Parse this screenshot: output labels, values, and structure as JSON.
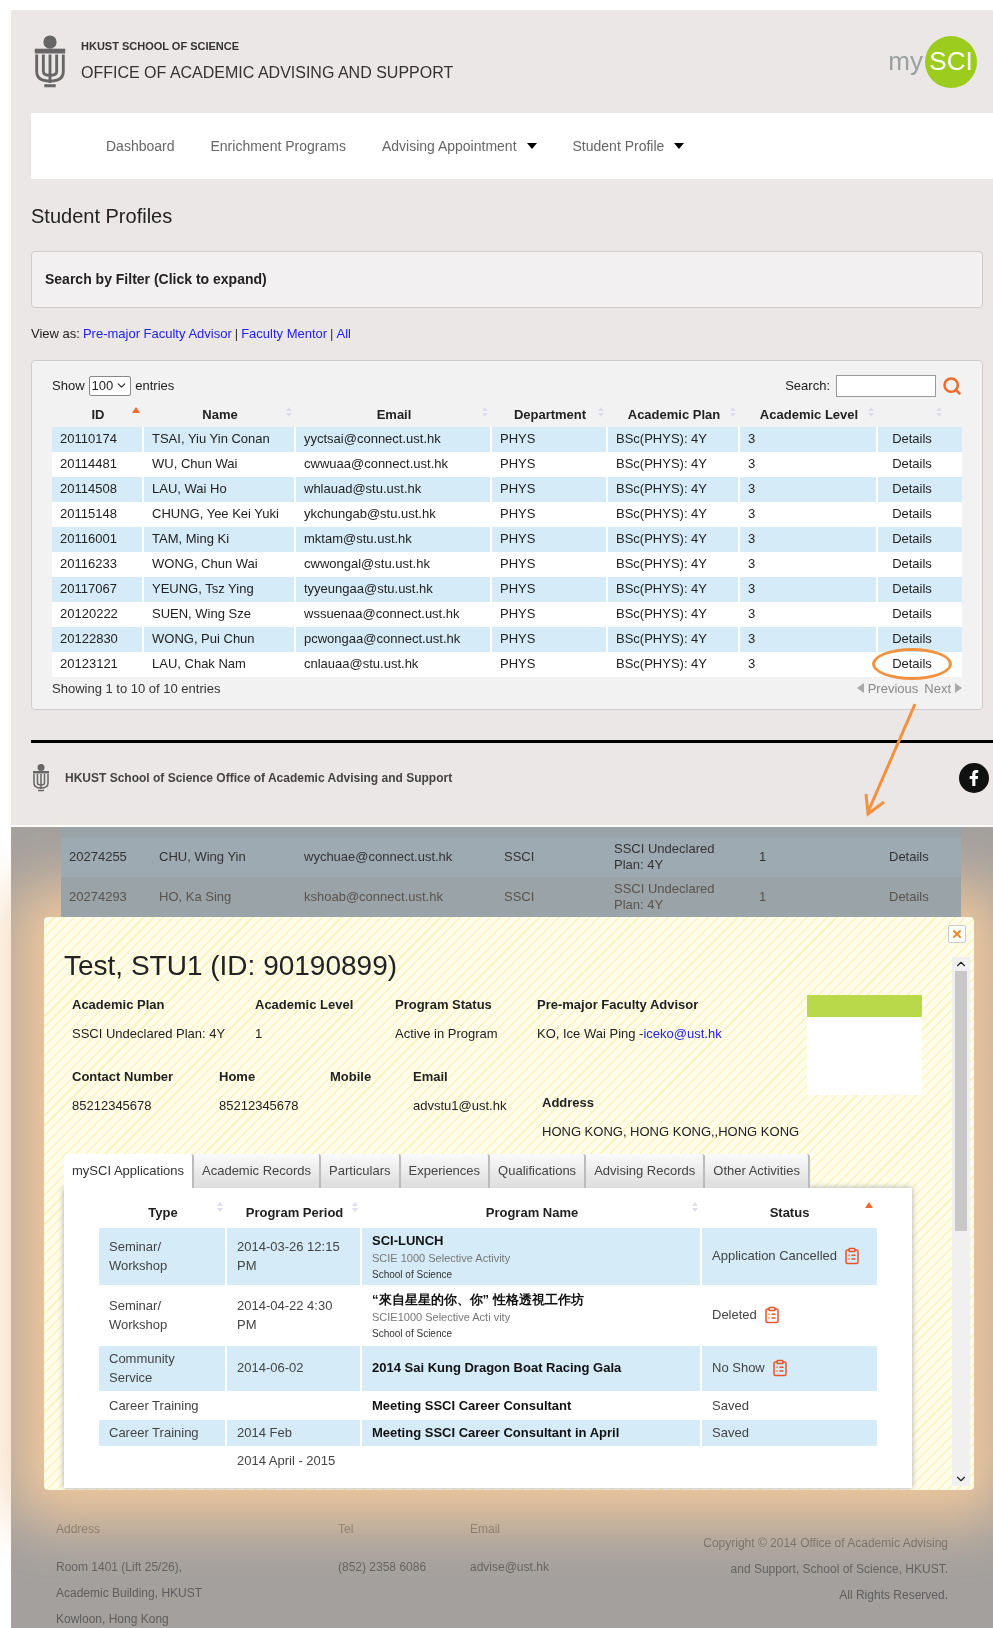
{
  "header": {
    "school": "HKUST SCHOOL OF SCIENCE",
    "office": "OFFICE OF ACADEMIC ADVISING AND SUPPORT",
    "logo_prefix": "my",
    "logo_badge": "SCI"
  },
  "nav": [
    {
      "label": "Dashboard",
      "has_dropdown": false
    },
    {
      "label": "Enrichment Programs",
      "has_dropdown": false
    },
    {
      "label": "Advising Appointment",
      "has_dropdown": true
    },
    {
      "label": "Student Profile",
      "has_dropdown": true
    }
  ],
  "page_title": "Student Profiles",
  "filter_panel": {
    "title": "Search by Filter (Click to expand)"
  },
  "view_as": {
    "label": "View as:",
    "separator": "|",
    "links": [
      "Pre-major Faculty Advisor",
      "Faculty Mentor",
      "All"
    ]
  },
  "table": {
    "show_label": "Show",
    "page_size": "100",
    "entries_label": "entries",
    "search_label": "Search:",
    "columns": [
      {
        "label": "ID",
        "sorted": true
      },
      {
        "label": "Name",
        "sorted": false
      },
      {
        "label": "Email",
        "sorted": false
      },
      {
        "label": "Department",
        "sorted": false
      },
      {
        "label": "Academic Plan",
        "sorted": false
      },
      {
        "label": "Academic Level",
        "sorted": false
      },
      {
        "sorted": false
      }
    ],
    "rows": [
      {
        "id": "20110174",
        "name": "TSAI, Yiu Yin Conan",
        "email": "yyctsai@connect.ust.hk",
        "department": "PHYS",
        "plan": "BSc(PHYS): 4Y",
        "level": "3",
        "action": "Details",
        "circled": false
      },
      {
        "id": "20114481",
        "name": "WU, Chun Wai",
        "email": "cwwuaa@connect.ust.hk",
        "department": "PHYS",
        "plan": "BSc(PHYS): 4Y",
        "level": "3",
        "action": "Details",
        "circled": false
      },
      {
        "id": "20114508",
        "name": "LAU, Wai Ho",
        "email": "whlauad@stu.ust.hk",
        "department": "PHYS",
        "plan": "BSc(PHYS): 4Y",
        "level": "3",
        "action": "Details",
        "circled": false
      },
      {
        "id": "20115148",
        "name": "CHUNG, Yee Kei Yuki",
        "email": "ykchungab@stu.ust.hk",
        "department": "PHYS",
        "plan": "BSc(PHYS): 4Y",
        "level": "3",
        "action": "Details",
        "circled": false
      },
      {
        "id": "20116001",
        "name": "TAM, Ming Ki",
        "email": "mktam@stu.ust.hk",
        "department": "PHYS",
        "plan": "BSc(PHYS): 4Y",
        "level": "3",
        "action": "Details",
        "circled": false
      },
      {
        "id": "20116233",
        "name": "WONG, Chun Wai",
        "email": "cwwongal@stu.ust.hk",
        "department": "PHYS",
        "plan": "BSc(PHYS): 4Y",
        "level": "3",
        "action": "Details",
        "circled": false
      },
      {
        "id": "20117067",
        "name": "YEUNG, Tsz Ying",
        "email": "tyyeungaa@stu.ust.hk",
        "department": "PHYS",
        "plan": "BSc(PHYS): 4Y",
        "level": "3",
        "action": "Details",
        "circled": false
      },
      {
        "id": "20120222",
        "name": "SUEN, Wing Sze",
        "email": "wssuenaa@connect.ust.hk",
        "department": "PHYS",
        "plan": "BSc(PHYS): 4Y",
        "level": "3",
        "action": "Details",
        "circled": false
      },
      {
        "id": "20122830",
        "name": "WONG, Pui Chun",
        "email": "pcwongaa@connect.ust.hk",
        "department": "PHYS",
        "plan": "BSc(PHYS): 4Y",
        "level": "3",
        "action": "Details",
        "circled": false
      },
      {
        "id": "20123121",
        "name": "LAU, Chak Nam",
        "email": "cnlauaa@stu.ust.hk",
        "department": "PHYS",
        "plan": "BSc(PHYS): 4Y",
        "level": "3",
        "action": "Details",
        "circled": true
      }
    ],
    "info": "Showing 1 to 10 of 10 entries",
    "previous": "Previous",
    "next": "Next"
  },
  "site_footer": {
    "text": "HKUST School of Science Office of Academic Advising and Support"
  },
  "background_rows": [
    {
      "id": "20274255",
      "name": "CHU, Wing Yin",
      "email": "wychuae@connect.ust.hk",
      "department": "SSCI",
      "plan": "SSCI Undeclared Plan: 4Y",
      "level": "1",
      "action": "Details"
    },
    {
      "id": "20274293",
      "name": "HO, Ka Sing",
      "email": "kshoab@connect.ust.hk",
      "department": "SSCI",
      "plan": "SSCI Undeclared Plan: 4Y",
      "level": "1",
      "action": "Details"
    }
  ],
  "modal": {
    "title": "Test, STU1 (ID: 90190899)",
    "fields_row1": [
      {
        "label": "Academic Plan",
        "value": "SSCI Undeclared Plan: 4Y"
      },
      {
        "label": "Academic Level",
        "value": "1"
      },
      {
        "label": "Program Status",
        "value": "Active in Program"
      },
      {
        "label": "Pre-major Faculty Advisor",
        "value": "KO, Ice Wai Ping - ",
        "link": "iceko@ust.hk"
      }
    ],
    "fields_row2": [
      {
        "label": "Contact Number",
        "value": "85212345678"
      },
      {
        "label": "Home",
        "value": "85212345678"
      },
      {
        "label": "Mobile"
      },
      {
        "label": "Email",
        "value": "advstu1@ust.hk"
      }
    ],
    "address": {
      "label": "Address",
      "value": "HONG KONG, HONG KONG,,HONG KONG"
    },
    "tabs": [
      {
        "label": "mySCI Applications",
        "selected": true
      },
      {
        "label": "Academic Records",
        "selected": false
      },
      {
        "label": "Particulars",
        "selected": false
      },
      {
        "label": "Experiences",
        "selected": false
      },
      {
        "label": "Qualifications",
        "selected": false
      },
      {
        "label": "Advising Records",
        "selected": false
      },
      {
        "label": "Other Activities",
        "selected": false
      }
    ],
    "columns": [
      {
        "label": "Type",
        "sorted": false
      },
      {
        "label": "Program Period",
        "sorted": false
      },
      {
        "label": "Program Name",
        "sorted": false
      },
      {
        "label": "Status",
        "sorted": true
      }
    ],
    "rows": [
      {
        "type": "Seminar/ Workshop",
        "period": "2014-03-26 12:15 PM",
        "name": "SCI-LUNCH",
        "course": "SCIE 1000 Selective Activity",
        "school": "School of Science",
        "status": "Application Cancelled",
        "has_icon": true
      },
      {
        "type": "Seminar/ Workshop",
        "period": "2014-04-22 4:30 PM",
        "name": "“來自星星的你、你” 性格透視工作坊",
        "course": "SCIE1000 Selective Acti vity",
        "school": "School of Science",
        "status": "Deleted",
        "has_icon": true
      },
      {
        "type": "Community Service",
        "period": "2014-06-02",
        "name": "2014 Sai Kung Dragon Boat Racing Gala",
        "status": "No Show",
        "has_icon": true
      },
      {
        "type": "Career Training",
        "name": "Meeting SSCI Career Consultant",
        "status": "Saved",
        "has_icon": false
      },
      {
        "type": "Career Training",
        "period": "2014 Feb",
        "name": "Meeting SSCI Career Consultant in April",
        "status": "Saved",
        "has_icon": false
      },
      {
        "period": "2014 April - 2015",
        "has_icon": false
      }
    ]
  },
  "bottom_footer": {
    "columns": [
      {
        "label": "Address",
        "lines": [
          "Room 1401 (Lift 25/26),",
          "Academic Building, HKUST",
          "Kowloon, Hong Kong"
        ]
      },
      {
        "label": "Tel",
        "lines": [
          "(852) 2358 6086"
        ]
      },
      {
        "label": "Email",
        "lines": [
          "advise@ust.hk"
        ]
      }
    ],
    "copyright": [
      "Copyright © 2014 Office of Academic Advising",
      "and Support, School of Science, HKUST.",
      "All Rights Reserved."
    ]
  }
}
